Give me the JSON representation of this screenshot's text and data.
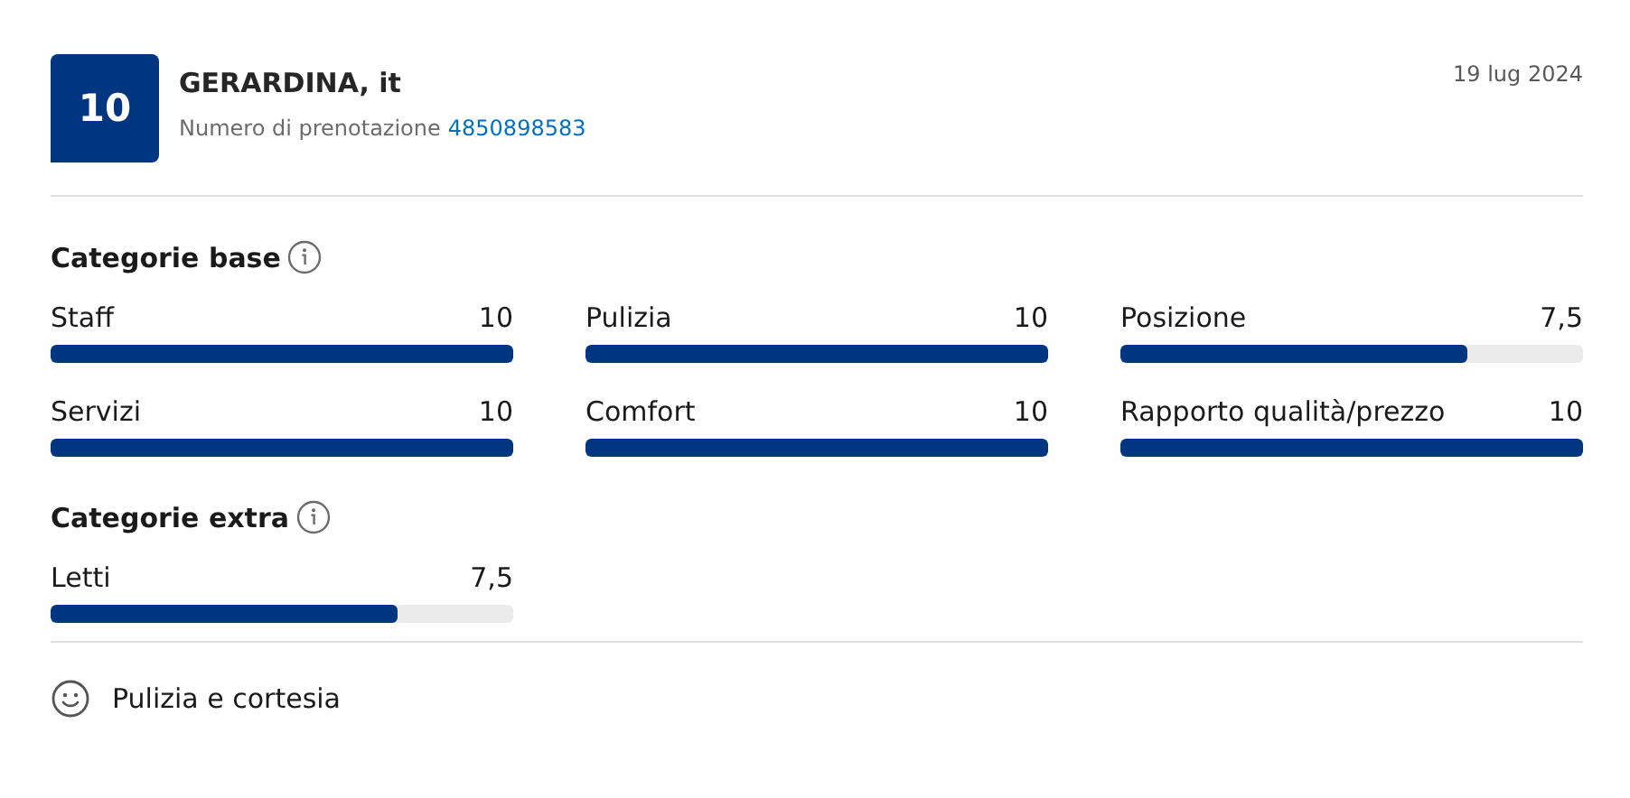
{
  "review": {
    "score": "10",
    "reviewer": "GERARDINA, it",
    "booking_label": "Numero di prenotazione",
    "booking_number": "4850898583",
    "date": "19 lug 2024"
  },
  "sections": [
    {
      "title": "Categorie base",
      "categories": [
        {
          "name": "Staff",
          "score": "10",
          "level": 1
        },
        {
          "name": "Pulizia",
          "score": "10",
          "level": 1
        },
        {
          "name": "Posizione",
          "score": "7,5",
          "level": 0.75
        },
        {
          "name": "Servizi",
          "score": "10",
          "level": 1
        },
        {
          "name": "Comfort",
          "score": "10",
          "level": 1
        },
        {
          "name": "Rapporto qualità/prezzo",
          "score": "10",
          "level": 1
        }
      ]
    },
    {
      "title": "Categorie extra",
      "categories": [
        {
          "name": "Letti",
          "score": "7,5",
          "level": 0.75
        }
      ]
    }
  ],
  "highlight": {
    "label": "Pulizia e cortesia"
  }
}
